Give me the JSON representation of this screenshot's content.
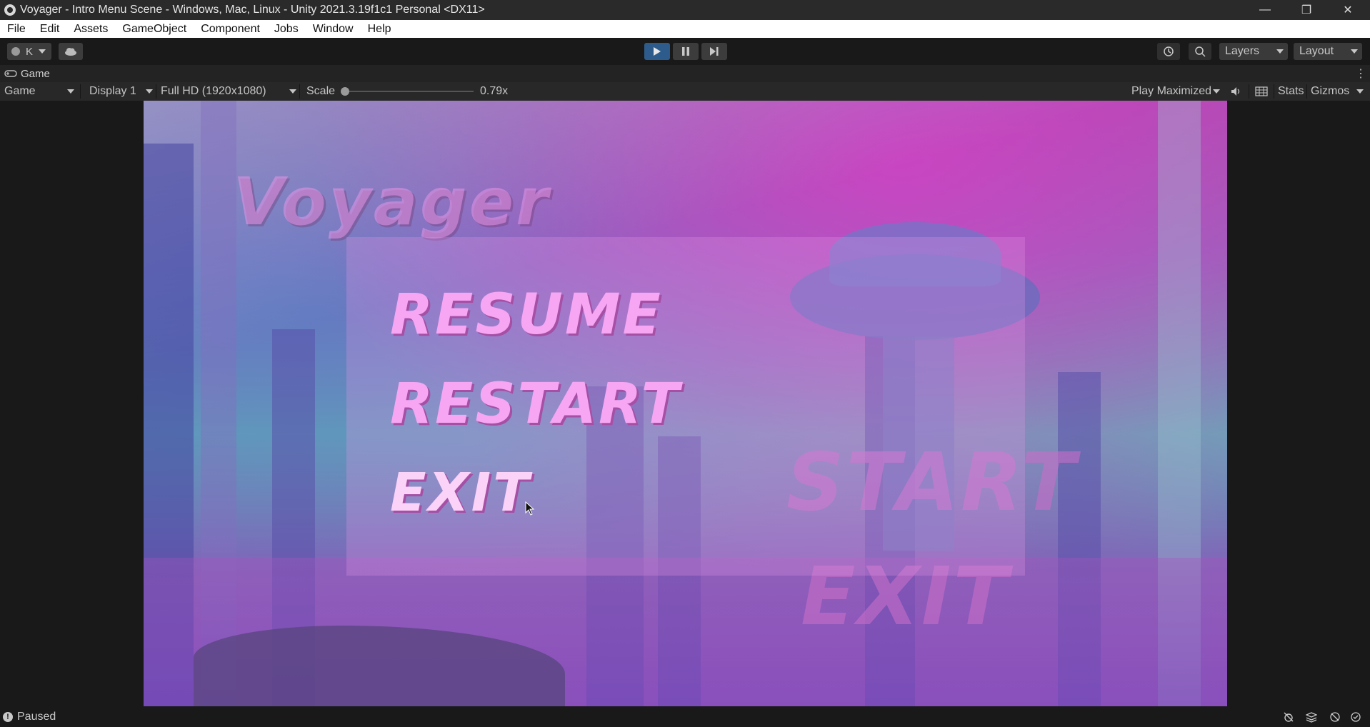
{
  "window": {
    "title": "Voyager - Intro Menu Scene - Windows, Mac, Linux - Unity 2021.3.19f1c1 Personal <DX11>"
  },
  "menu": [
    "File",
    "Edit",
    "Assets",
    "GameObject",
    "Component",
    "Jobs",
    "Window",
    "Help"
  ],
  "toolbar": {
    "account_label": "K",
    "layers_label": "Layers",
    "layout_label": "Layout"
  },
  "tab": {
    "label": "Game"
  },
  "game_toolbar": {
    "view_mode": "Game",
    "display": "Display 1",
    "resolution": "Full HD (1920x1080)",
    "scale_label": "Scale",
    "scale_value": "0.79x",
    "scale_fraction": 0.0,
    "play_mode": "Play Maximized",
    "stats": "Stats",
    "gizmos": "Gizmos"
  },
  "game": {
    "title_text": "Voyager",
    "menu_items": [
      "RESUME",
      "RESTART",
      "EXIT"
    ],
    "background_buttons": [
      "START",
      "EXIT"
    ]
  },
  "status": {
    "text": "Paused"
  },
  "colors": {
    "menu_pink": "#f6a6f2",
    "play_active": "#2d5c8c",
    "accent_bg": "#191919"
  }
}
